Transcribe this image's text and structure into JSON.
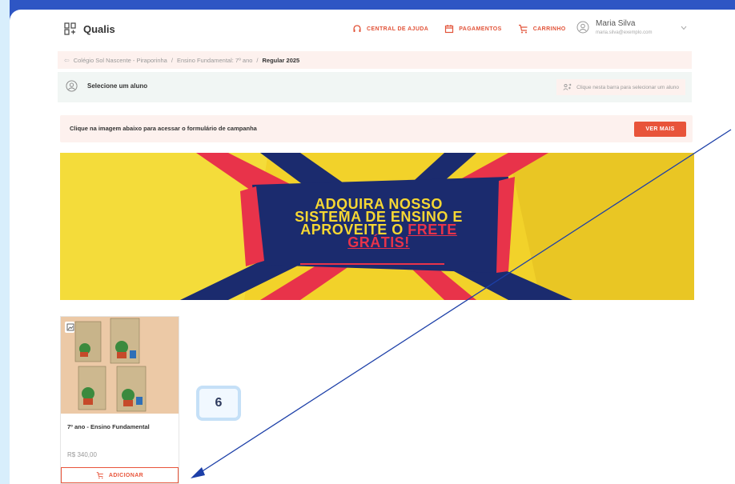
{
  "header": {
    "brand": "Qualis",
    "nav": [
      {
        "label": "CENTRAL DE AJUDA",
        "icon": "headset-icon"
      },
      {
        "label": "PAGAMENTOS",
        "icon": "calendar-icon"
      },
      {
        "label": "CARRINHO",
        "icon": "cart-icon"
      }
    ],
    "user": {
      "name": "Maria Silva",
      "email": "maria.silva@exemplo.com"
    }
  },
  "breadcrumb": {
    "items": [
      "Colégio Sol Nascente - Piraporinha",
      "Ensino Fundamental: 7º ano"
    ],
    "separator": "/",
    "current": "Regular 2025"
  },
  "student_selector": {
    "label": "Selecione um aluno",
    "hint": "Clique nesta barra para selecionar um aluno"
  },
  "campaign": {
    "text": "Clique na imagem abaixo para acessar o formulário de campanha",
    "button": "VER MAIS"
  },
  "banner": {
    "line1": "ADQUIRA NOSSO",
    "line2": "SISTEMA DE ENSINO E",
    "line3a": "APROVEITE O",
    "line3b": "FRETE",
    "line4": "GRÁTIS!"
  },
  "product": {
    "title": "7º ano - Ensino Fundamental",
    "price": "R$ 340,00",
    "button": "ADICIONAR"
  },
  "annotation": {
    "step": "6"
  },
  "colors": {
    "accent": "#e8543a",
    "frame": "#2e56c4",
    "banner_yellow": "#f2d22a",
    "banner_navy": "#1b2b6e"
  }
}
